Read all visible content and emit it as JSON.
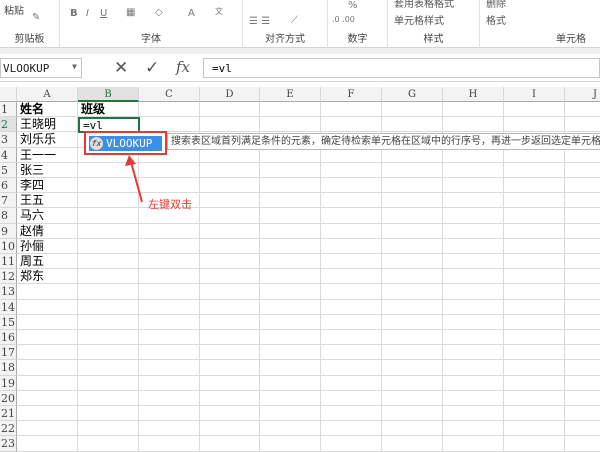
{
  "ribbon": {
    "groups": [
      {
        "label": "剪贴板",
        "button": "粘贴"
      },
      {
        "label": "字体",
        "bold": "B",
        "italic": "I",
        "underline": "U",
        "font_color": "A"
      },
      {
        "label": "对齐方式"
      },
      {
        "label": "数字",
        "percent": "%"
      },
      {
        "label": "样式",
        "table_style": "套用表格格式",
        "cell_style": "单元格样式"
      },
      {
        "label": "单元格",
        "delete": "删除",
        "format": "格式"
      }
    ]
  },
  "formula_bar": {
    "name_box": "VLOOKUP",
    "cancel": "✕",
    "enter": "✓",
    "fx": "fx",
    "formula": "=vl"
  },
  "columns": [
    "A",
    "B",
    "C",
    "D",
    "E",
    "F",
    "G",
    "H",
    "I",
    "J"
  ],
  "rows": [
    "1",
    "2",
    "3",
    "4",
    "5",
    "6",
    "7",
    "8",
    "9",
    "10",
    "11",
    "12",
    "13",
    "14",
    "15",
    "16",
    "17",
    "18",
    "19",
    "20",
    "21",
    "22",
    "23"
  ],
  "cells": {
    "A1": "姓名",
    "B1": "班级",
    "B2": "=vl",
    "A": [
      "王晓明",
      "刘乐乐",
      "王一一",
      "张三",
      "李四",
      "王五",
      "马六",
      "赵倩",
      "孙俪",
      "周五",
      "郑东"
    ]
  },
  "autocomplete": {
    "item": "VLOOKUP",
    "icon": "fx",
    "tooltip": "搜索表区域首列满足条件的元素，确定待检索单元格在区域中的行序号，再进一步返回选定单元格的值"
  },
  "annotation": "左键双击"
}
